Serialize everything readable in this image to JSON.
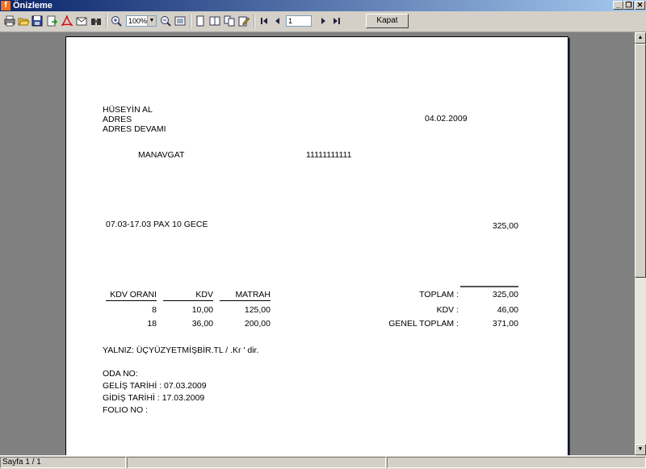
{
  "window": {
    "title": "Önizleme",
    "app_icon_letter": "f"
  },
  "toolbar": {
    "zoom_value": "100%",
    "page_value": "1",
    "close_label": "Kapat"
  },
  "icons": [
    "print-icon",
    "open-icon",
    "save-icon",
    "export-icon",
    "pdf-icon",
    "email-icon",
    "find-icon",
    "zoom-in-icon",
    "zoom-out-icon",
    "fit-page-icon",
    "single-page-icon",
    "two-pages-icon",
    "multi-pages-icon",
    "edit-icon",
    "first-page-icon",
    "prev-page-icon",
    "next-page-icon",
    "last-page-icon"
  ],
  "document": {
    "name": "HÜSEYİN AL",
    "address1": "ADRES",
    "address2": "ADRES DEVAMI",
    "date": "04.02.2009",
    "city": "MANAVGAT",
    "tax_no": "11111111111",
    "line_item": {
      "description": "07.03-17.03 PAX 10 GECE",
      "amount": "325,00"
    },
    "kdv_table": {
      "headers": [
        "KDV ORANI",
        "KDV",
        "MATRAH"
      ],
      "rows": [
        [
          "8",
          "10,00",
          "125,00"
        ],
        [
          "18",
          "36,00",
          "200,00"
        ]
      ]
    },
    "totals": [
      {
        "label": "TOPLAM :",
        "value": "325,00"
      },
      {
        "label": "KDV :",
        "value": "46,00"
      },
      {
        "label": "GENEL TOPLAM :",
        "value": "371,00"
      }
    ],
    "amount_in_words": "YALNIZ: ÜÇYÜZYETMİŞBİR.TL / .Kr  ' dir.",
    "oda_no": "ODA NO:",
    "gelis": "GELİŞ TARİHİ : 07.03.2009",
    "gidis": "GİDİŞ TARİHİ : 17.03.2009",
    "folio": "FOLIO NO :"
  },
  "status": {
    "page_info": "Sayfa 1 / 1"
  }
}
